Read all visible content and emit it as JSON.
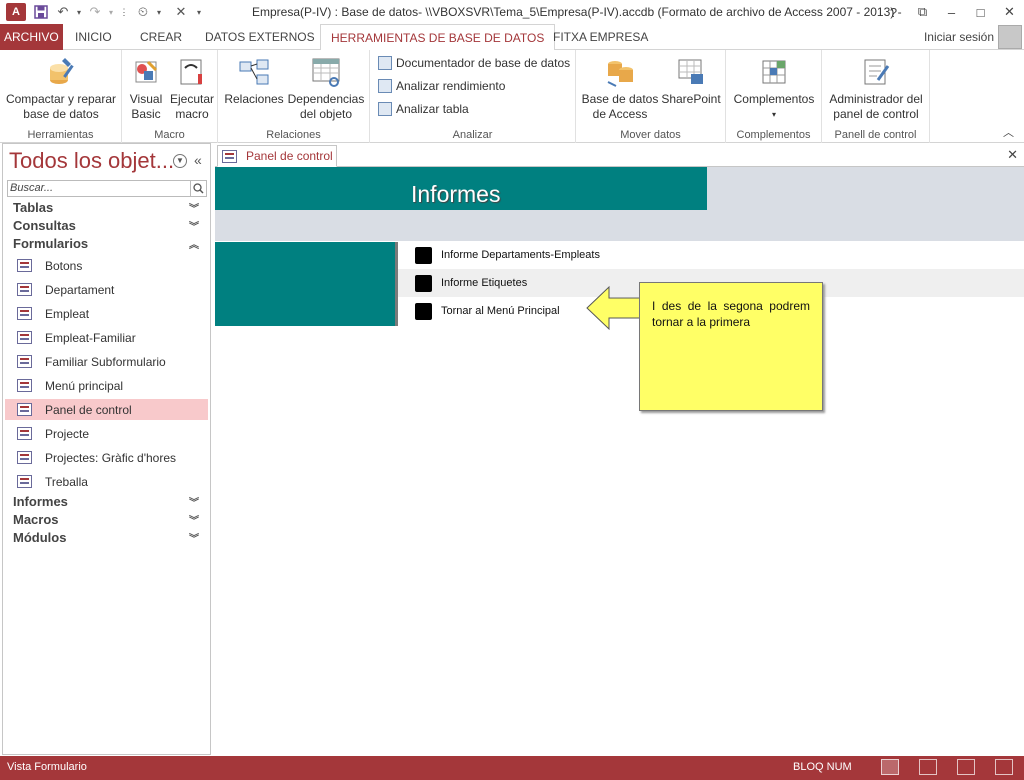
{
  "titlebar": {
    "app_icon": "A",
    "title": "Empresa(P-IV) : Base de datos- \\\\VBOXSVR\\Tema_5\\Empresa(P-IV).accdb (Formato de archivo de Access 2007 - 2013) - A...",
    "help": "?",
    "restore": "⧉",
    "minimize": "–",
    "maximize": "□",
    "close": "✕"
  },
  "ribbon_tabs": {
    "file": "ARCHIVO",
    "items": [
      "INICIO",
      "CREAR",
      "DATOS EXTERNOS",
      "HERRAMIENTAS DE BASE DE DATOS",
      "FITXA EMPRESA"
    ],
    "active": "HERRAMIENTAS DE BASE DE DATOS",
    "signin": "Iniciar sesión"
  },
  "ribbon": {
    "groups": {
      "herramientas": "Herramientas",
      "macro": "Macro",
      "relaciones": "Relaciones",
      "analizar": "Analizar",
      "mover": "Mover datos",
      "complementos": "Complementos",
      "panel": "Panell de control"
    },
    "buttons": {
      "compactar_1": "Compactar y reparar",
      "compactar_2": "base de datos",
      "vb_1": "Visual",
      "vb_2": "Basic",
      "ejecutar_1": "Ejecutar",
      "ejecutar_2": "macro",
      "relaciones": "Relaciones",
      "dependencias_1": "Dependencias",
      "dependencias_2": "del objeto",
      "documentador": "Documentador de base de datos",
      "rendimiento": "Analizar rendimiento",
      "tabla": "Analizar tabla",
      "access_1": "Base de datos",
      "access_2": "de Access",
      "sharepoint": "SharePoint",
      "complementos": "Complementos",
      "admin_1": "Administrador del",
      "admin_2": "panel de control"
    }
  },
  "nav": {
    "title": "Todos los objet...",
    "search_placeholder": "Buscar...",
    "groups": {
      "tablas": "Tablas",
      "consultas": "Consultas",
      "formularios": "Formularios",
      "informes": "Informes",
      "macros": "Macros",
      "modulos": "Módulos"
    },
    "forms": [
      "Botons",
      "Departament",
      "Empleat",
      "Empleat-Familiar",
      "Familiar Subformulario",
      "Menú principal",
      "Panel de control",
      "Projecte",
      "Projectes: Gràfic d'hores",
      "Treballa"
    ],
    "selected_form": "Panel de control"
  },
  "document": {
    "tab_label": "Panel de control",
    "header_title": "Informes",
    "menu_items": [
      "Informe Departaments-Empleats",
      "Informe Etiquetes",
      "Tornar al Menú Principal"
    ],
    "callout_text": "I des de la segona podrem tornar a la primera",
    "callout_color": "#ffff66",
    "teal_color": "#008080"
  },
  "statusbar": {
    "left": "Vista Formulario",
    "numlock": "BLOQ NUM"
  },
  "colors": {
    "access_red": "#a4373a"
  }
}
